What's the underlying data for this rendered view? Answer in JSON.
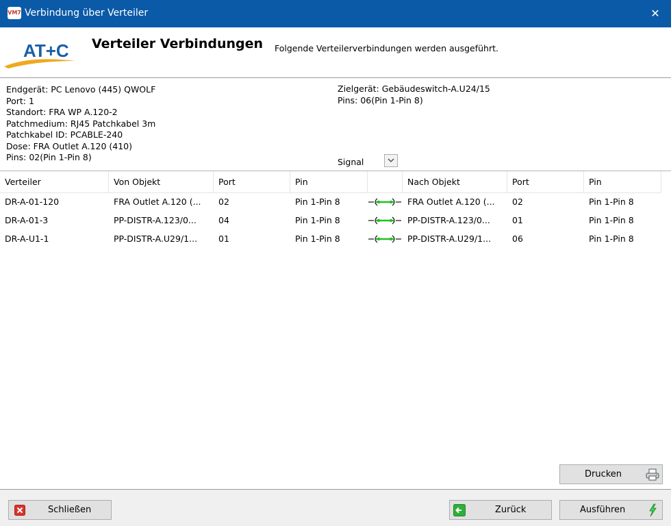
{
  "window": {
    "title": "Verbindung über Verteiler",
    "icon_text": "VM7",
    "close_glyph": "✕"
  },
  "header": {
    "logo_text": "AT+C",
    "title": "Verteiler Verbindungen",
    "description": "Folgende Verteilerverbindungen werden ausgeführt."
  },
  "source": {
    "endgeraet": "Endgerät: PC Lenovo (445) QWOLF",
    "port": "Port: 1",
    "standort": "Standort: FRA WP A.120-2",
    "patchmedium": "Patchmedium: RJ45 Patchkabel 3m",
    "patchkabel_id": "Patchkabel ID: PCABLE-240",
    "dose": "Dose: FRA Outlet A.120 (410)",
    "pins": "Pins: 02(Pin 1-Pin 8)"
  },
  "target": {
    "zielgeraet": "Zielgerät: Gebäudeswitch-A.U24/15",
    "pins": "Pins: 06(Pin 1-Pin 8)"
  },
  "signal": {
    "label": "Signal"
  },
  "table": {
    "columns": {
      "verteiler": "Verteiler",
      "von_objekt": "Von Objekt",
      "port1": "Port",
      "pin1": "Pin",
      "nach_objekt": "Nach Objekt",
      "port2": "Port",
      "pin2": "Pin"
    },
    "rows": [
      {
        "verteiler": "DR-A-01-120",
        "von_objekt": "FRA Outlet A.120 (...",
        "port1": "02",
        "pin1": "Pin 1-Pin 8",
        "nach_objekt": "FRA Outlet A.120 (...",
        "port2": "02",
        "pin2": "Pin 1-Pin 8"
      },
      {
        "verteiler": "DR-A-01-3",
        "von_objekt": "PP-DISTR-A.123/0...",
        "port1": "04",
        "pin1": "Pin 1-Pin 8",
        "nach_objekt": "PP-DISTR-A.123/0...",
        "port2": "01",
        "pin2": "Pin 1-Pin 8"
      },
      {
        "verteiler": "DR-A-U1-1",
        "von_objekt": "PP-DISTR-A.U29/1...",
        "port1": "01",
        "pin1": "Pin 1-Pin 8",
        "nach_objekt": "PP-DISTR-A.U29/1...",
        "port2": "06",
        "pin2": "Pin 1-Pin 8"
      }
    ]
  },
  "buttons": {
    "drucken": "Drucken",
    "schliessen": "Schließen",
    "zurueck": "Zurück",
    "ausfuehren": "Ausführen"
  },
  "colors": {
    "titlebar": "#0a5aa8",
    "logo_blue": "#1b5fa8",
    "logo_orange": "#f0a81e",
    "connection_green": "#22c022",
    "close_red": "#d9342b",
    "back_green": "#2fae3a"
  }
}
